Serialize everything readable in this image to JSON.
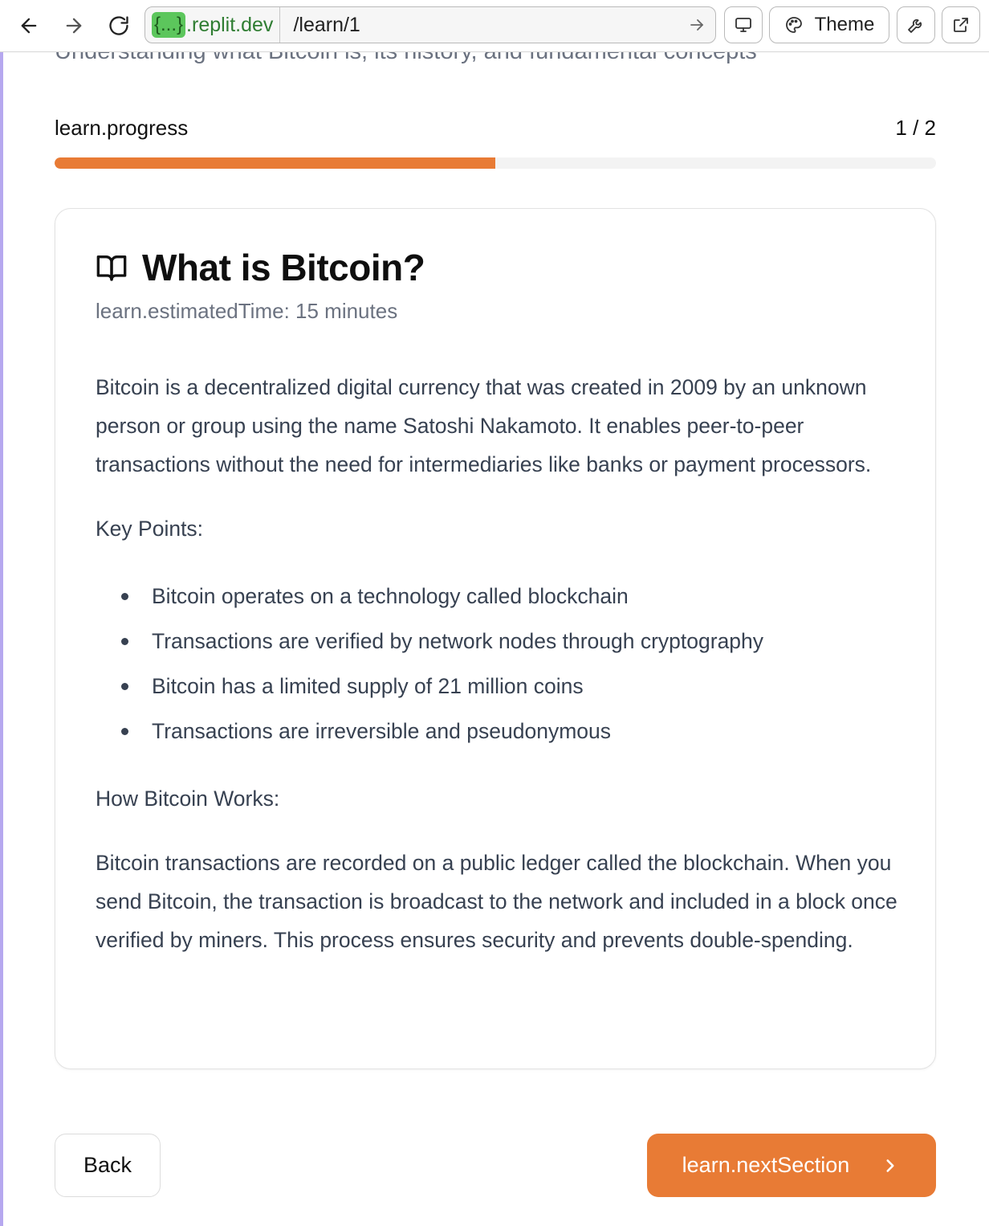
{
  "browser": {
    "url_domain_badge": "{...}",
    "url_domain": ".replit.dev",
    "url_path": "/learn/1",
    "theme_label": "Theme"
  },
  "page": {
    "subtitle": "Understanding what Bitcoin is, its history, and fundamental concepts",
    "progress_label": "learn.progress",
    "progress_count": "1 / 2",
    "progress_fraction": 0.5
  },
  "lesson": {
    "title": "What is Bitcoin?",
    "meta": "learn.estimatedTime: 15 minutes",
    "intro": "Bitcoin is a decentralized digital currency that was created in 2009 by an unknown person or group using the name Satoshi Nakamoto. It enables peer-to-peer transactions without the need for intermediaries like banks or payment processors.",
    "key_points_heading": "Key Points:",
    "key_points": [
      "Bitcoin operates on a technology called blockchain",
      "Transactions are verified by network nodes through cryptography",
      "Bitcoin has a limited supply of 21 million coins",
      "Transactions are irreversible and pseudonymous"
    ],
    "how_heading": "How Bitcoin Works:",
    "how_text": "Bitcoin transactions are recorded on a public ledger called the blockchain. When you send Bitcoin, the transaction is broadcast to the network and included in a block once verified by miners. This process ensures security and prevents double-spending."
  },
  "actions": {
    "back_label": "Back",
    "next_label": "learn.nextSection"
  },
  "colors": {
    "accent": "#e87b35",
    "url_domain": "#2f7d32"
  }
}
